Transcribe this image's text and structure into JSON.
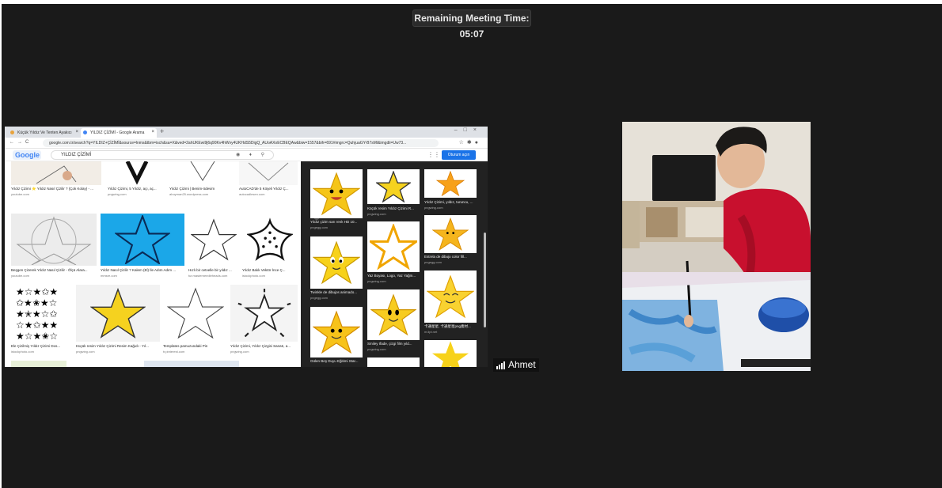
{
  "meeting": {
    "remaining_label": "Remaining Meeting Time: 05:07",
    "participant_name": "Ahmet"
  },
  "browser": {
    "tab1": "Küçük Yıldız Ve Tenten Ayakıcı",
    "tab2": "YILDIZ ÇİZİMİ - Google Arama",
    "url": "google.com.tr/search?q=YILDIZ+ÇİZİMİ&source=lnms&tbm=isch&sa=X&ved=2ahUKEwi9j6q90Kv4hWvy4UKHdS5DigQ_AUoAXoECBEQAw&biw=1557&bih=691#imgrc=QuhjuaGY-B7sMl&imgdii=Uw73..."
  },
  "google": {
    "logo": "Google",
    "query": "YILDIZ ÇİZİMİ",
    "signin": "Oturum açın"
  },
  "results": [
    {
      "cap": "Yıldız Çizimi ⭐ Yıldız Nasıl Çizilir ? (Çok Kolay) - ...",
      "src": "youtube.com"
    },
    {
      "cap": "Yıldız Çizimi, 5 Yıldız, açı, aç...",
      "src": "pngwing.com"
    },
    {
      "cap": "Yıldız Çizimi | Benim-ödevim",
      "src": "ahoyman25.wordpress.com"
    },
    {
      "cap": "AutoCAD'de 5 Köşeli Yıldız Ç...",
      "src": "autocadlesen.com"
    },
    {
      "cap": "Beşgen Çizerek Yıldız Nasıl Çizilir - Ölçü Alara...",
      "src": "youtube.com"
    },
    {
      "cap": "Yıldız Nasıl Çizilir ? Kalem (El) İle Adım Adım ...",
      "src": "mmsre.com"
    },
    {
      "cap": "Hızlı bir cetvelle bir yıldız ...",
      "src": "tur.masterneedleheads.com"
    },
    {
      "cap": "Yıldız Balık Vektör İnce Ç...",
      "src": "istockphoto.com"
    },
    {
      "cap": "Ele Çizilmiş Yıldız Çizimi Dos...",
      "src": "istockphoto.com"
    },
    {
      "cap": "Küçük resim Yıldız Çizimi Resim Kağıdı - Yıl...",
      "src": "pngwing.com"
    },
    {
      "cap": "Templates pamuzundaki Pin",
      "src": "tr.pinterest.com"
    },
    {
      "cap": "Yıldız Çizimi, Yıldız Çizgisi Sanatı, a...",
      "src": "pngwing.com"
    }
  ],
  "panel": [
    {
      "cap": "Yıldız çizim sarı renk HD 10...",
      "src": "pngegg.com"
    },
    {
      "cap": "Küçük resim Yıldız Çizimi R...",
      "src": "pngwing.com"
    },
    {
      "cap": "Yıldız Çizimi, yıldız, turuncu, ...",
      "src": "pngwing.com"
    },
    {
      "cap": "Twinkle de dibujos animado...",
      "src": "pngegg.com"
    },
    {
      "cap": "Yaz Boyası, Logo, Yaz Yağm...",
      "src": "pngwing.com"
    },
    {
      "cap": "Estrela de dibujo color fill...",
      "src": "pngegg.com"
    },
    {
      "cap": "Gülen Beş Duyu Eğitimi Star...",
      "src": "pngwing.com"
    },
    {
      "cap": "Smiley Ifade, çizgi film yıld...",
      "src": "pngwing.com"
    },
    {
      "cap": "卡通星星, 卡通星星png素材...",
      "src": "m.lipt.net"
    }
  ],
  "colors": {
    "meeting_bg": "#1a1a1a",
    "accent_blue": "#1a73e8",
    "star_yellow": "#f5d21f"
  }
}
